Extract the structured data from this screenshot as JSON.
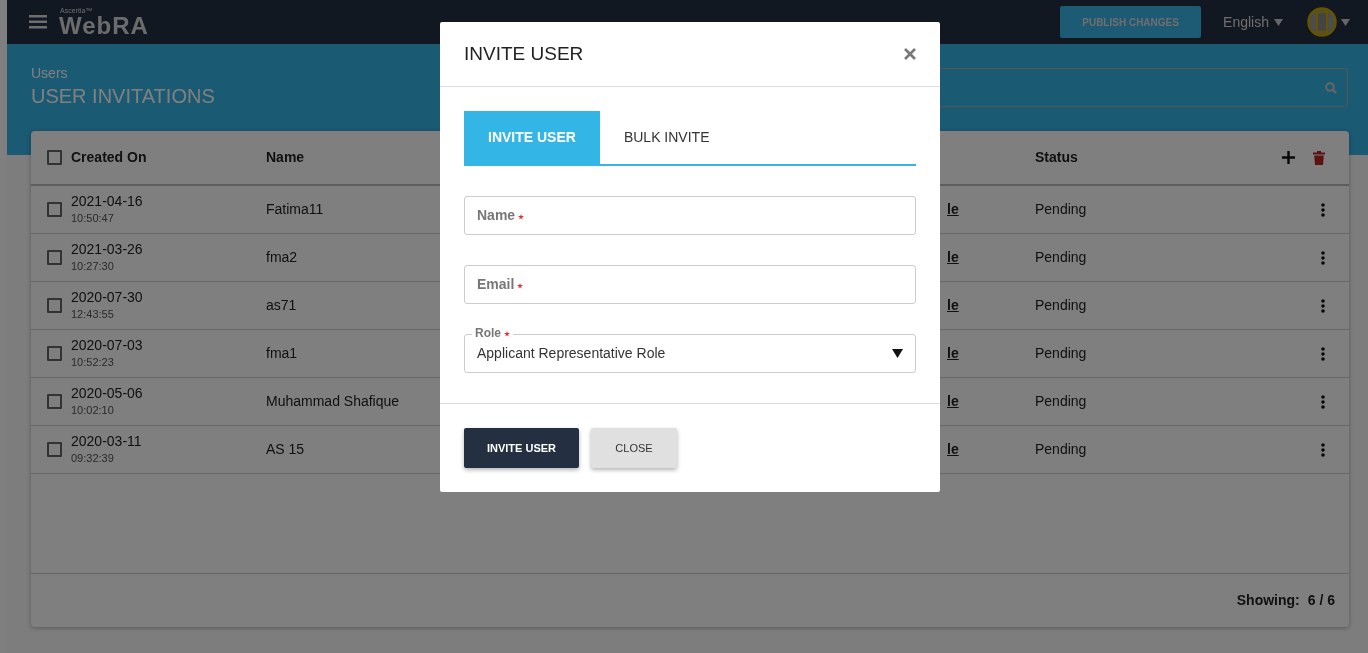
{
  "navbar": {
    "logo_super": "Ascertia™",
    "logo": "WebRA",
    "publish_button": "PUBLISH CHANGES",
    "language": "English"
  },
  "header": {
    "breadcrumb": "Users",
    "title": "USER INVITATIONS"
  },
  "table": {
    "select_all_checked": false,
    "columns": [
      {
        "label": "Created On"
      },
      {
        "label": "Name"
      },
      {
        "label": "Status"
      }
    ],
    "rows": [
      {
        "checked": false,
        "date": "2021-04-16",
        "time": "10:50:47",
        "name": "Fatima11",
        "role": "le",
        "status": "Pending"
      },
      {
        "checked": false,
        "date": "2021-03-26",
        "time": "10:27:30",
        "name": "fma2",
        "role": "le",
        "status": "Pending"
      },
      {
        "checked": false,
        "date": "2020-07-30",
        "time": "12:43:55",
        "name": "as71",
        "role": "le",
        "status": "Pending"
      },
      {
        "checked": false,
        "date": "2020-07-03",
        "time": "10:52:23",
        "name": "fma1",
        "role": "le",
        "status": "Pending"
      },
      {
        "checked": false,
        "date": "2020-05-06",
        "time": "10:02:10",
        "name": "Muhammad Shafique",
        "role": "le",
        "status": "Pending"
      },
      {
        "checked": false,
        "date": "2020-03-11",
        "time": "09:32:39",
        "name": "AS 15",
        "role": "le",
        "status": "Pending"
      }
    ],
    "footer": {
      "label": "Showing:",
      "value": "6 / 6"
    }
  },
  "modal": {
    "title": "INVITE USER",
    "tabs": [
      {
        "label": "INVITE USER",
        "selected": true
      },
      {
        "label": "BULK INVITE",
        "selected": false
      }
    ],
    "fields": [
      {
        "kind": "text",
        "label": "Name",
        "required": true
      },
      {
        "kind": "text",
        "label": "Email",
        "required": true
      },
      {
        "kind": "select",
        "label": "Role",
        "required": true,
        "value": "Applicant Representative Role"
      }
    ],
    "buttons": [
      {
        "kind": "primary",
        "label": "INVITE USER"
      },
      {
        "kind": "secondary",
        "label": "CLOSE"
      }
    ]
  }
}
